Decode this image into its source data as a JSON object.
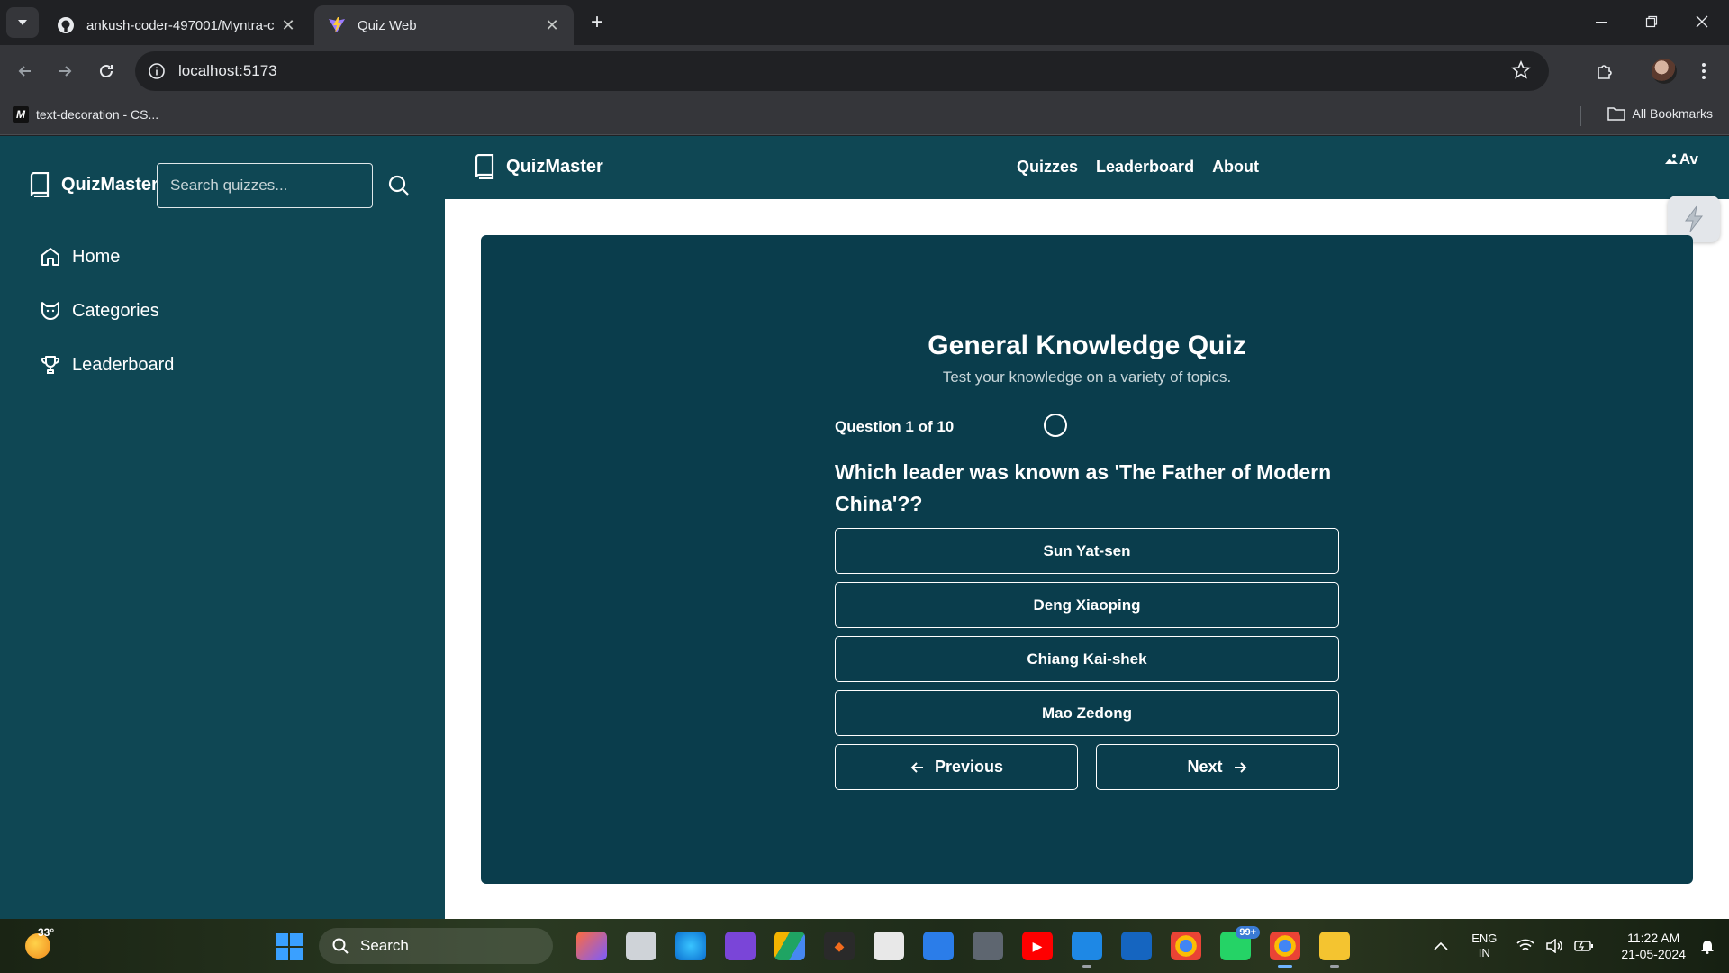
{
  "browser": {
    "tabs": [
      {
        "title": "ankush-coder-497001/Myntra-c",
        "icon": "github-icon",
        "active": false
      },
      {
        "title": "Quiz Web",
        "icon": "vite-icon",
        "active": true
      }
    ],
    "url": "localhost:5173",
    "bookmarks": [
      {
        "label": "text-decoration - CS..."
      }
    ],
    "all_bookmarks_label": "All Bookmarks"
  },
  "sidebar": {
    "brand": "QuizMaster",
    "search_placeholder": "Search quizzes...",
    "items": [
      {
        "label": "Home",
        "icon": "home-icon"
      },
      {
        "label": "Categories",
        "icon": "cat-icon"
      },
      {
        "label": "Leaderboard",
        "icon": "trophy-icon"
      }
    ]
  },
  "header": {
    "brand": "QuizMaster",
    "links": [
      "Quizzes",
      "Leaderboard",
      "About"
    ],
    "avatar_alt": "Av"
  },
  "quiz": {
    "title": "General Knowledge Quiz",
    "subtitle": "Test your knowledge on a variety of topics.",
    "progress": "Question 1 of 10",
    "question": "Which leader was known as 'The Father of Modern China'??",
    "options": [
      "Sun Yat-sen",
      "Deng Xiaoping",
      "Chiang Kai-shek",
      "Mao Zedong"
    ],
    "prev_label": "Previous",
    "next_label": "Next"
  },
  "taskbar": {
    "temperature": "33°",
    "search_label": "Search",
    "notification_badge": "99+",
    "lang_line1": "ENG",
    "lang_line2": "IN",
    "time": "11:22 AM",
    "date": "21-05-2024"
  },
  "colors": {
    "sidebar_bg": "#0f4754",
    "card_bg": "#0a3d4c",
    "page_bg": "#ffffff",
    "text": "#ffffff"
  }
}
